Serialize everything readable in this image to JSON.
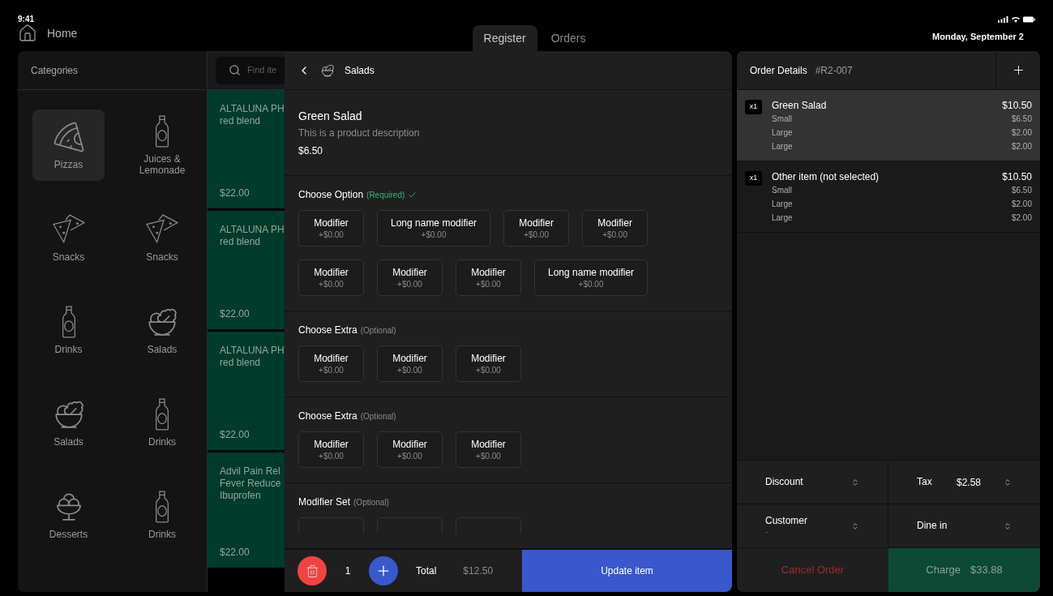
{
  "status_bar": {
    "time": "9:41"
  },
  "nav": {
    "home_label": "Home",
    "tabs": [
      {
        "label": "Register",
        "selected": true
      },
      {
        "label": "Orders",
        "selected": false
      }
    ],
    "date": "Monday, September 2"
  },
  "categories": {
    "title": "Categories",
    "items": [
      {
        "label": "Pizzas",
        "kind": "pizza",
        "selected": true
      },
      {
        "label": "Juices & Lemonade",
        "kind": "bottle",
        "selected": false
      },
      {
        "label": "Snacks",
        "kind": "nachos",
        "selected": false
      },
      {
        "label": "Snacks",
        "kind": "nachos",
        "selected": false
      },
      {
        "label": "Drinks",
        "kind": "bottle",
        "selected": false
      },
      {
        "label": "Salads",
        "kind": "salad",
        "selected": false
      },
      {
        "label": "Salads",
        "kind": "salad",
        "selected": false
      },
      {
        "label": "Drinks",
        "kind": "bottle",
        "selected": false
      },
      {
        "label": "Desserts",
        "kind": "dessert",
        "selected": false
      },
      {
        "label": "Drinks",
        "kind": "bottle",
        "selected": false
      }
    ]
  },
  "search": {
    "placeholder": "Find ite"
  },
  "products": [
    {
      "name": "ALTALUNA PH\nred blend",
      "price": "$22.00"
    },
    {
      "name": "ALTALUNA PH\nred blend",
      "price": "$22.00"
    },
    {
      "name": "ALTALUNA PH\nred blend",
      "price": "$22.00"
    },
    {
      "name": "Advil Pain Rel\nFever Reduce\nIbuprofen",
      "price": "$22.00"
    }
  ],
  "modal": {
    "category": "Salads",
    "product": {
      "name": "Green Salad",
      "description": "This is a product description",
      "price": "$6.50"
    },
    "sections": [
      {
        "title": "Choose Option",
        "note": "(Required)",
        "required": true,
        "modifiers": [
          {
            "name": "Modifier",
            "price": "+$0.00"
          },
          {
            "name": "Long name modifier",
            "price": "+$0.00"
          },
          {
            "name": "Modifier",
            "price": "+$0.00"
          },
          {
            "name": "Modifier",
            "price": "+$0.00"
          },
          {
            "name": "Modifier",
            "price": "+$0.00"
          },
          {
            "name": "Modifier",
            "price": "+$0.00"
          },
          {
            "name": "Modifier",
            "price": "+$0.00"
          },
          {
            "name": "Long name modifier",
            "price": "+$0.00"
          }
        ]
      },
      {
        "title": "Choose Extra",
        "note": "(Optional)",
        "required": false,
        "modifiers": [
          {
            "name": "Modifier",
            "price": "+$0.00"
          },
          {
            "name": "Modifier",
            "price": "+$0.00"
          },
          {
            "name": "Modifier",
            "price": "+$0.00"
          }
        ]
      },
      {
        "title": "Choose Extra",
        "note": "(Optional)",
        "required": false,
        "modifiers": [
          {
            "name": "Modifier",
            "price": "+$0.00"
          },
          {
            "name": "Modifier",
            "price": "+$0.00"
          },
          {
            "name": "Modifier",
            "price": "+$0.00"
          }
        ]
      },
      {
        "title": "Modifier Set",
        "note": "(Optional)",
        "required": false,
        "modifiers": [
          {
            "kind": "cut"
          },
          {
            "kind": "cut"
          },
          {
            "kind": "cut"
          }
        ]
      }
    ],
    "footer": {
      "quantity": "1",
      "total_label": "Total",
      "total": "$12.50",
      "update_label": "Update item"
    }
  },
  "order": {
    "title": "Order Details",
    "number": "#R2-007",
    "items": [
      {
        "qty": "x1",
        "name": "Green Salad",
        "price": "$10.50",
        "selected": true,
        "lines": [
          {
            "name": "Small",
            "price": "$6.50"
          },
          {
            "name": "Large",
            "price": "$2.00"
          },
          {
            "name": "Large",
            "price": "$2.00"
          }
        ]
      },
      {
        "qty": "x1",
        "name": "Other item (not selected)",
        "price": "$10.50",
        "selected": false,
        "lines": [
          {
            "name": "Small",
            "price": "$6.50"
          },
          {
            "name": "Large",
            "price": "$2.00"
          },
          {
            "name": "Large",
            "price": "$2.00"
          }
        ]
      }
    ],
    "controls": [
      {
        "label": "Discount"
      },
      {
        "label": "Tax",
        "value": "$2.58"
      },
      {
        "label": "Customer",
        "sublabel": "-"
      },
      {
        "label": "Dine in"
      }
    ],
    "cancel_label": "Cancel Order",
    "charge_label": "Charge",
    "charge_amount": "$33.88"
  }
}
